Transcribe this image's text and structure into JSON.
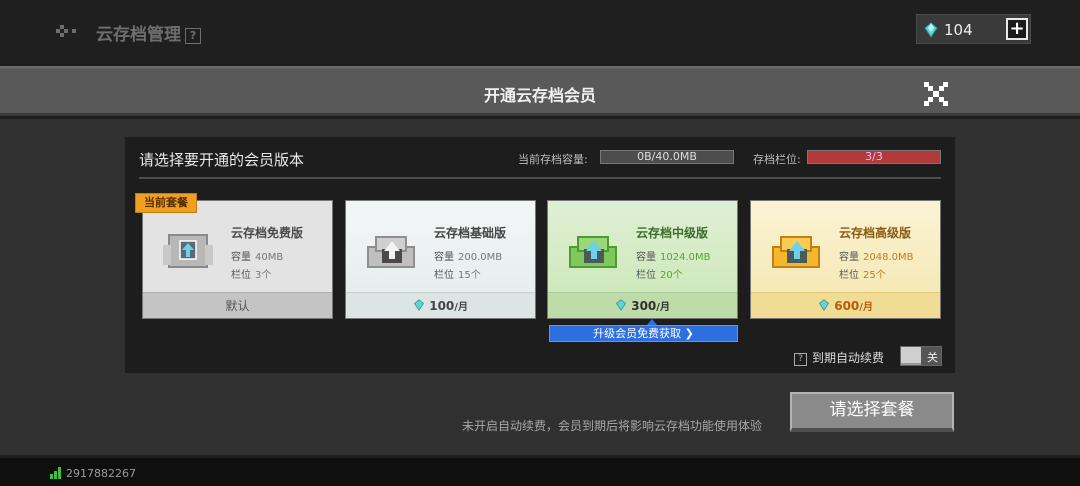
{
  "topbar": {
    "title": "云存档管理",
    "help": "?",
    "diamonds": "104",
    "add_label": "+"
  },
  "modal": {
    "title": "开通云存档会员"
  },
  "panel": {
    "title": "请选择要开通的会员版本",
    "capacity_label": "当前存档容量:",
    "capacity_value": "0B/40.0MB",
    "slots_label": "存档栏位:",
    "slots_value": "3/3"
  },
  "current_tag": "当前套餐",
  "plans": [
    {
      "name": "云存档免费版",
      "cap_label": "容量",
      "cap": "40MB",
      "slot_label": "栏位",
      "slots": "3个",
      "footer": "默认"
    },
    {
      "name": "云存档基础版",
      "cap_label": "容量",
      "cap": "200.0MB",
      "slot_label": "栏位",
      "slots": "15个",
      "price": "100",
      "unit": "/月"
    },
    {
      "name": "云存档中级版",
      "cap_label": "容量",
      "cap": "1024.0MB",
      "slot_label": "栏位",
      "slots": "20个",
      "price": "300",
      "unit": "/月"
    },
    {
      "name": "云存档高级版",
      "cap_label": "容量",
      "cap": "2048.0MB",
      "slot_label": "栏位",
      "slots": "25个",
      "price": "600",
      "unit": "/月"
    }
  ],
  "promo": "升级会员免费获取 ❯",
  "auto_renew": {
    "label": "到期自动续费",
    "state": "关"
  },
  "footer_note": "未开启自动续费，会员到期后将影响云存档功能使用体验",
  "select_button": "请选择套餐",
  "status": {
    "user_id": "2917882267"
  },
  "colors": {
    "accent_blue": "#2e6fe0",
    "current_tag": "#f0a020",
    "slot_bar": "#b33a3a",
    "diamond": "#5fd6d6"
  }
}
